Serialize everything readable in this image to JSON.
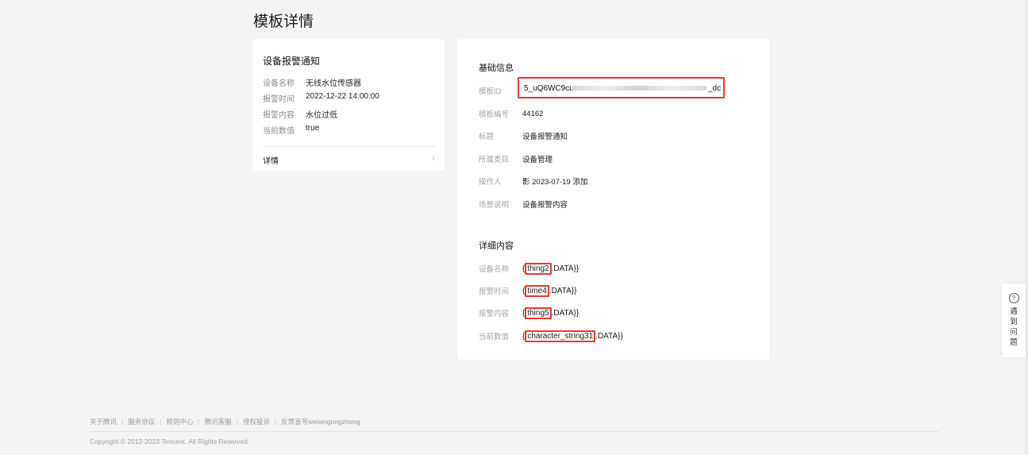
{
  "page": {
    "title": "模板详情"
  },
  "preview": {
    "title": "设备报警通知",
    "fields": [
      {
        "label": "设备名称",
        "value": "无线水位传感器"
      },
      {
        "label": "报警时间",
        "value": "2022-12-22 14:00:00"
      },
      {
        "label": "报警内容",
        "value": "水位过低"
      },
      {
        "label": "当前数值",
        "value": "true"
      }
    ],
    "detail_link": "详情"
  },
  "basic_info": {
    "title": "基础信息",
    "template_id": {
      "label": "模板ID",
      "prefix": "5_uQ6WC9cu",
      "suffix": "_dc"
    },
    "template_no": {
      "label": "模板编号",
      "value": "44162"
    },
    "heading": {
      "label": "标题",
      "value": "设备报警通知"
    },
    "category": {
      "label": "所属类目",
      "value": "设备管理"
    },
    "operator": {
      "label": "操作人",
      "value": "影 2023-07-19 添加"
    },
    "scene": {
      "label": "场景说明",
      "value": "设备报警内容"
    }
  },
  "detail_content": {
    "title": "详细内容",
    "rows": [
      {
        "label": "设备名称",
        "open": "{",
        "key": "thing2",
        "close": ".DATA}}"
      },
      {
        "label": "报警时间",
        "open": "{",
        "key": "time4",
        "close": ".DATA}}"
      },
      {
        "label": "报警内容",
        "open": "{",
        "key": "thing5",
        "close": ".DATA}}"
      },
      {
        "label": "当前数值",
        "open": "{",
        "key": "character_string31",
        "close": ".DATA}}"
      }
    ]
  },
  "help": {
    "icon": "question-icon",
    "glyph": "?",
    "label": "遇到问题"
  },
  "footer": {
    "links": [
      "关于腾讯",
      "服务协议",
      "规则中心",
      "腾讯客服",
      "侵权投诉",
      "反馈盲号weixingongzhong"
    ],
    "separator": "|",
    "copyright": "Copyright © 2012-2023 Tencent. All Rights Reserved."
  },
  "colors": {
    "highlight": "#e53935",
    "background": "#f3f4f6"
  }
}
